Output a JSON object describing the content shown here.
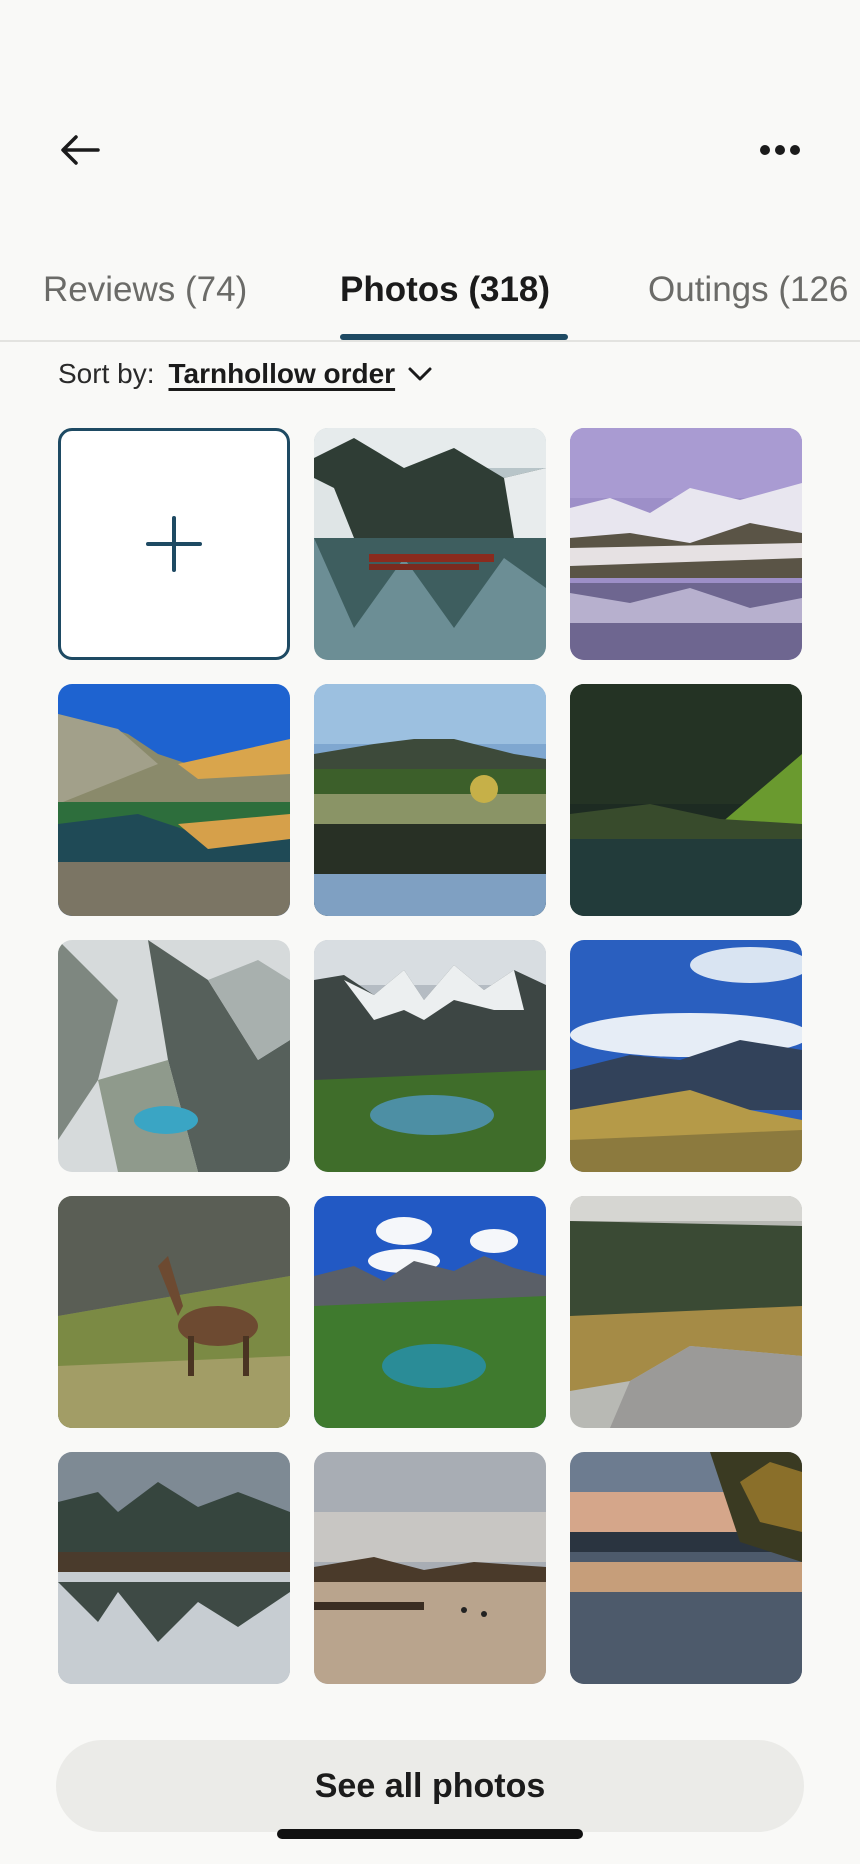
{
  "header": {
    "back_icon": "arrow-left-icon",
    "more_icon": "more-horizontal-icon"
  },
  "tabs": [
    {
      "label": "Reviews (74)",
      "active": false
    },
    {
      "label": "Photos (318)",
      "active": true
    },
    {
      "label": "Outings (126",
      "active": false
    }
  ],
  "sort": {
    "label": "Sort by:",
    "value": "Tarnhollow order",
    "icon": "chevron-down-icon"
  },
  "add_tile_icon": "plus-icon",
  "photos": [
    "snowy-mountain-lake-with-red-boats",
    "purple-sky-snow-mountain-reflection",
    "alpine-lake-blue-sky-reflection",
    "forest-lake-reflection-mountain",
    "dark-green-forest-lake",
    "aerial-mountain-turquoise-tarn",
    "jagged-peaks-green-valley-lake",
    "blue-sky-clouds-mountain-meadow",
    "chamois-on-rocky-slope",
    "turquoise-lake-cloudy-peaks",
    "misty-forest-lake-shore",
    "foggy-forest-lake-reflection",
    "sunrise-lake-with-dock",
    "sunset-lake-with-tree"
  ],
  "footer": {
    "see_all_label": "See all photos"
  },
  "colors": {
    "accent": "#1e4a63",
    "background": "#f9f9f7",
    "button_bg": "#ebebe8"
  }
}
